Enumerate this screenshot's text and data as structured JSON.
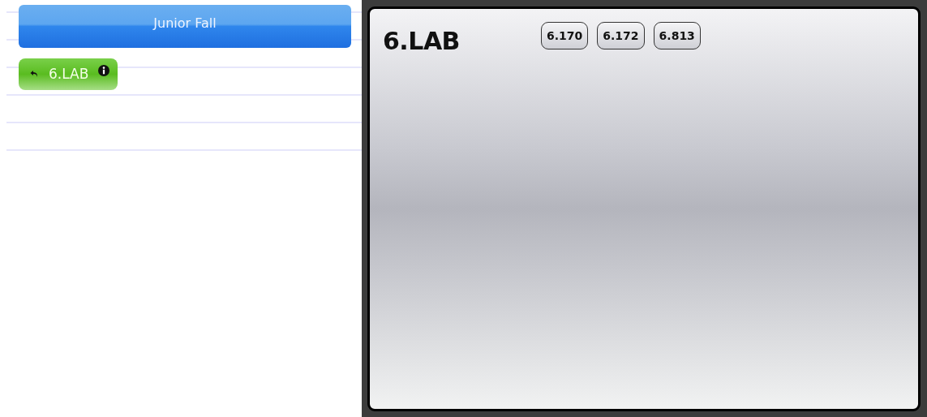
{
  "sidebar": {
    "header_button": "Junior Fall",
    "items": [
      {
        "label": "6.LAB",
        "selected": true
      }
    ]
  },
  "panel": {
    "title": "6.LAB",
    "courses": [
      {
        "label": "6.170"
      },
      {
        "label": "6.172"
      },
      {
        "label": "6.813"
      }
    ]
  }
}
